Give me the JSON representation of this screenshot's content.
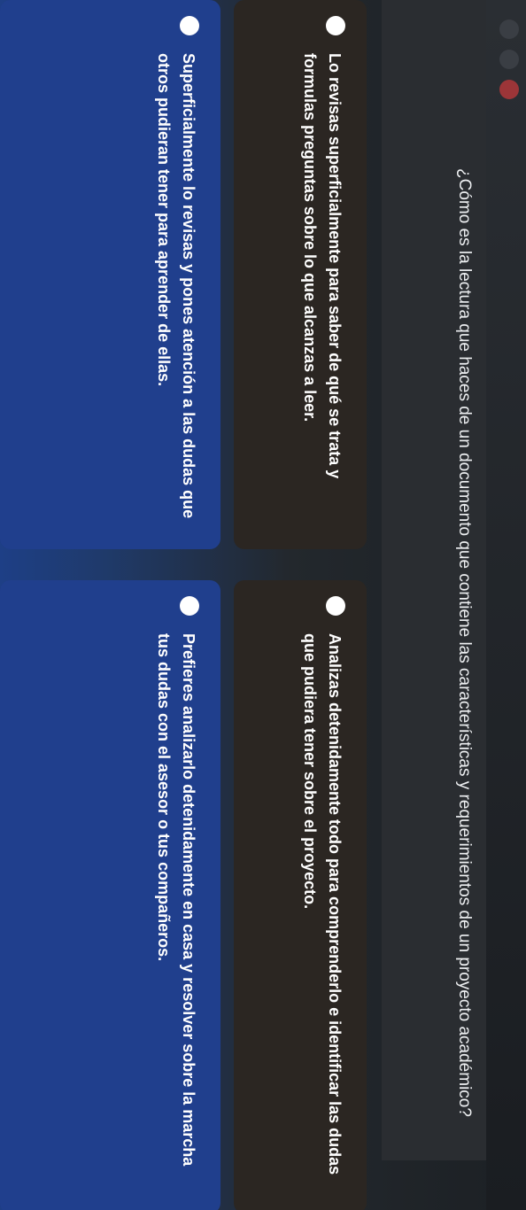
{
  "question": {
    "text": "¿Cómo es la lectura que haces de un documento que contiene las características y requerimientos de un proyecto académico?"
  },
  "answers": [
    {
      "label": "Lo revisas superficialmente para saber de qué se trata y formulas preguntas sobre lo que alcanzas a leer."
    },
    {
      "label": "Analizas detenidamente todo para comprenderlo e identificar las dudas que pudiera tener sobre el proyecto."
    },
    {
      "label": "Superficialmente lo revisas y pones atención a las dudas que otros pudieran tener para aprender de ellas."
    },
    {
      "label": "Prefieres analizarlo detenidamente en casa y resolver sobre la marcha tus dudas con el asesor o tus compañeros."
    }
  ],
  "colors": {
    "card_dark": "#2b2622",
    "card_blue": "#203f8d",
    "close_button": "#9c3538"
  }
}
